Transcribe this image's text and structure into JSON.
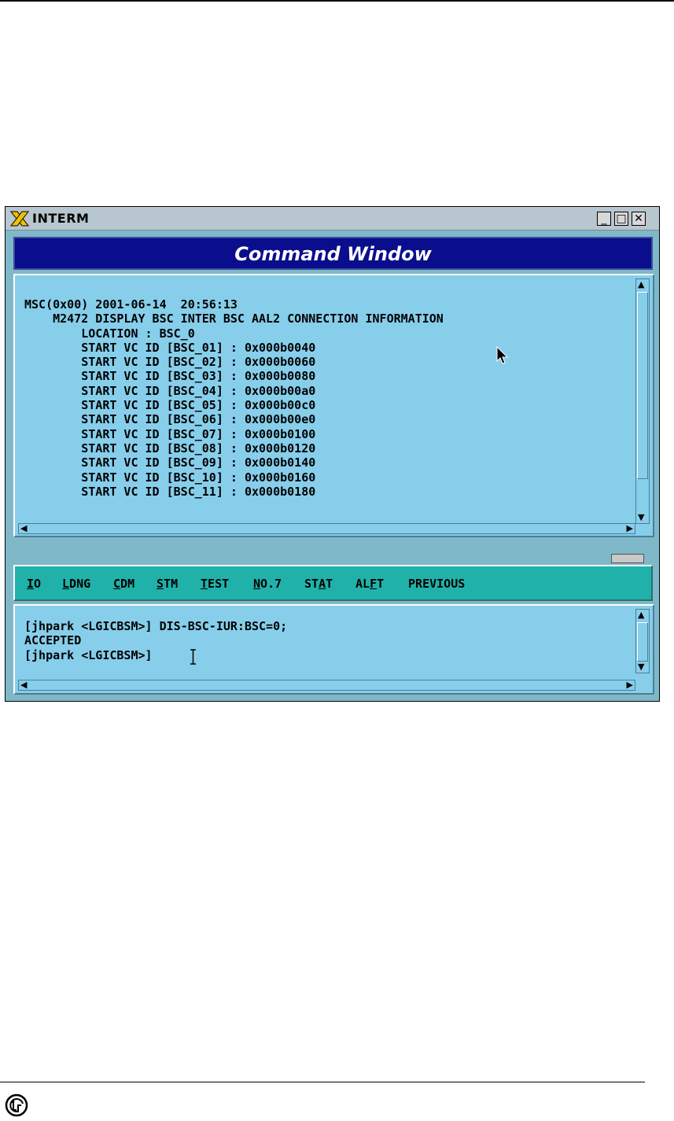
{
  "window": {
    "title": "INTERM",
    "header": "Command Window",
    "controls": {
      "minimize": "_",
      "maximize": "□",
      "close": "✕"
    }
  },
  "output": {
    "lines": [
      "MSC(0x00) 2001-06-14  20:56:13",
      "    M2472 DISPLAY BSC INTER BSC AAL2 CONNECTION INFORMATION",
      "        LOCATION : BSC_0",
      "        START VC ID [BSC_01] : 0x000b0040",
      "        START VC ID [BSC_02] : 0x000b0060",
      "        START VC ID [BSC_03] : 0x000b0080",
      "        START VC ID [BSC_04] : 0x000b00a0",
      "        START VC ID [BSC_05] : 0x000b00c0",
      "        START VC ID [BSC_06] : 0x000b00e0",
      "        START VC ID [BSC_07] : 0x000b0100",
      "        START VC ID [BSC_08] : 0x000b0120",
      "        START VC ID [BSC_09] : 0x000b0140",
      "        START VC ID [BSC_10] : 0x000b0160",
      "        START VC ID [BSC_11] : 0x000b0180"
    ]
  },
  "menu": {
    "items": [
      {
        "label": "IO",
        "mnemonic_index": 0
      },
      {
        "label": "LDNG",
        "mnemonic_index": 0
      },
      {
        "label": "CDM",
        "mnemonic_index": 0
      },
      {
        "label": "STM",
        "mnemonic_index": 0
      },
      {
        "label": "TEST",
        "mnemonic_index": 0
      },
      {
        "label": "NO.7",
        "mnemonic_index": 0
      },
      {
        "label": "STAT",
        "mnemonic_index": 2
      },
      {
        "label": "ALFT",
        "mnemonic_index": 2
      },
      {
        "label": "PREVIOUS",
        "mnemonic_index": -1
      }
    ]
  },
  "input": {
    "lines": [
      "[jhpark <LGICBSM>] DIS-BSC-IUR:BSC=0;",
      "ACCEPTED",
      "[jhpark <LGICBSM>]"
    ]
  },
  "icons": {
    "app": "x-window-icon",
    "logo": "lg-logo-icon",
    "pointer": "mouse-pointer-icon",
    "caret": "text-cursor-icon"
  },
  "colors": {
    "title_bar": "#b7c6cf",
    "header_bg": "#0a0e8c",
    "pane_bg": "#87ceeb",
    "menu_bg": "#20b2aa",
    "window_frame": "#7fb8c8"
  }
}
